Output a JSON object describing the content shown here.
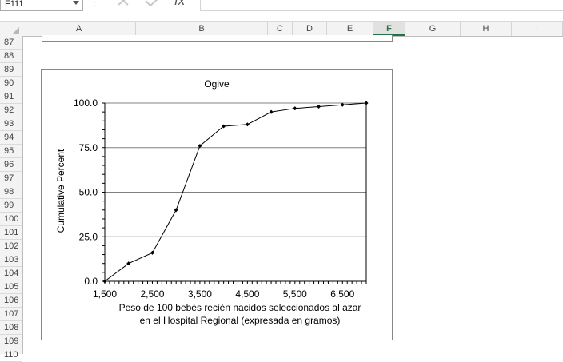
{
  "formula_bar": {
    "name_box": "F111",
    "separator": ":",
    "cancel_icon": "x-icon",
    "enter_icon": "check-icon",
    "fx_label": "fx",
    "formula_value": ""
  },
  "columns": [
    {
      "label": "A",
      "selected": false
    },
    {
      "label": "B",
      "selected": false
    },
    {
      "label": "C",
      "selected": false
    },
    {
      "label": "D",
      "selected": false
    },
    {
      "label": "E",
      "selected": false
    },
    {
      "label": "F",
      "selected": true
    },
    {
      "label": "G",
      "selected": false
    },
    {
      "label": "H",
      "selected": false
    },
    {
      "label": "I",
      "selected": false
    }
  ],
  "rows": [
    "87",
    "88",
    "89",
    "90",
    "91",
    "92",
    "93",
    "94",
    "95",
    "96",
    "97",
    "98",
    "99",
    "100",
    "101",
    "102",
    "103",
    "104",
    "105",
    "106",
    "107",
    "108",
    "109",
    "110"
  ],
  "colors": {
    "accent": "#217346",
    "gridline": "#808080",
    "series": "#000000"
  },
  "chart_data": {
    "type": "line",
    "title": "Ogive",
    "xlabel_lines": [
      "Peso de 100 bebés recién nacidos seleccionados al azar",
      "en el Hospital Regional (expresada en gramos)"
    ],
    "ylabel": "Cumulative Percent",
    "x_tick_labels": [
      "1,500",
      "2,500",
      "3,500",
      "4,500",
      "5,500",
      "6,500"
    ],
    "x_ticks": [
      1500,
      2500,
      3500,
      4500,
      5500,
      6500
    ],
    "y_tick_labels": [
      "0.0",
      "25.0",
      "50.0",
      "75.0",
      "100.0"
    ],
    "y_ticks": [
      0,
      25,
      50,
      75,
      100
    ],
    "xlim": [
      1500,
      7000
    ],
    "ylim": [
      0,
      100
    ],
    "grid": true,
    "series": [
      {
        "x": [
          1500,
          2000,
          2500,
          3000,
          3500,
          4000,
          4500,
          5000,
          5500,
          6000,
          6500,
          7000
        ],
        "y": [
          0,
          10,
          16,
          40,
          76,
          87,
          88,
          95,
          97,
          98,
          99,
          100
        ]
      }
    ]
  }
}
